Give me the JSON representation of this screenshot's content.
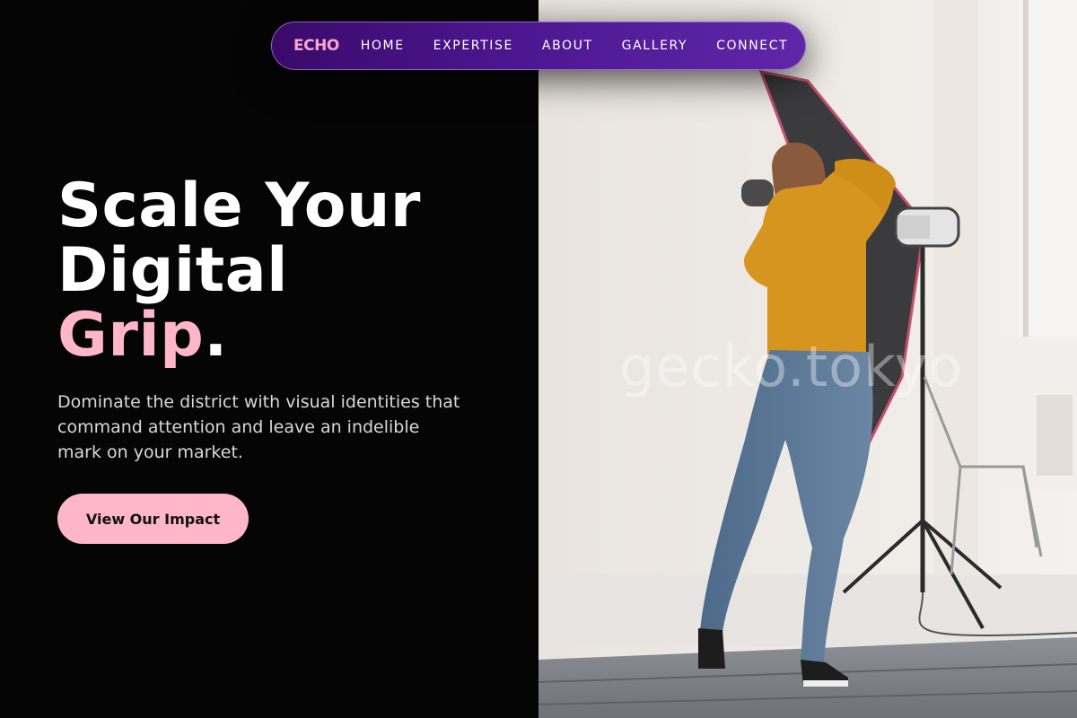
{
  "nav": {
    "brand": "ECHO",
    "links": [
      "HOME",
      "EXPERTISE",
      "ABOUT",
      "GALLERY",
      "CONNECT"
    ]
  },
  "hero": {
    "title_line1": "Scale Your",
    "title_line2": "Digital",
    "title_accent": "Grip",
    "title_period": ".",
    "subtitle": "Dominate the district with visual identities that command attention and leave an indelible mark on your market.",
    "cta_label": "View Our Impact"
  },
  "image": {
    "watermark": "gecko.tokyo",
    "subject": "photographer with studio lights"
  },
  "colors": {
    "accent_pink": "#ffb6c8",
    "nav_purple_start": "#3a0a6a",
    "nav_purple_end": "#5f27a8",
    "background": "#050505"
  }
}
